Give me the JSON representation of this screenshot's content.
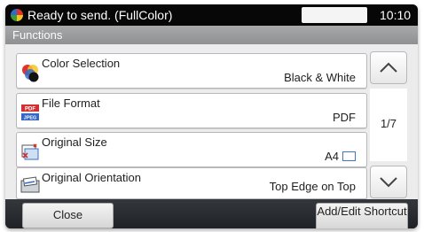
{
  "status": {
    "text": "Ready to send. (FullColor)",
    "time": "10:10",
    "icon": "color-mode-icon"
  },
  "header": {
    "title": "Functions"
  },
  "functions": [
    {
      "label": "Color Selection",
      "value": "Black & White",
      "icon": "color-selection-icon"
    },
    {
      "label": "File Format",
      "value": "PDF",
      "icon": "file-format-icon",
      "icon_text_top": "PDF",
      "icon_text_bottom": "JPEG"
    },
    {
      "label": "Original Size",
      "value": "A4",
      "icon": "original-size-icon"
    },
    {
      "label": "Original Orientation",
      "value": "Top Edge on Top",
      "icon": "original-orientation-icon"
    }
  ],
  "pager": {
    "indicator": "1/7",
    "up_icon": "chevron-up-icon",
    "down_icon": "chevron-down-icon"
  },
  "footer": {
    "close_label": "Close",
    "shortcut_label": "Add/Edit Shortcut"
  },
  "colors": {
    "status_bg": "#070707",
    "header_bg": "#9b9d9f",
    "screen_bg": "#ececec",
    "footer_bg": "#2b2e33"
  }
}
